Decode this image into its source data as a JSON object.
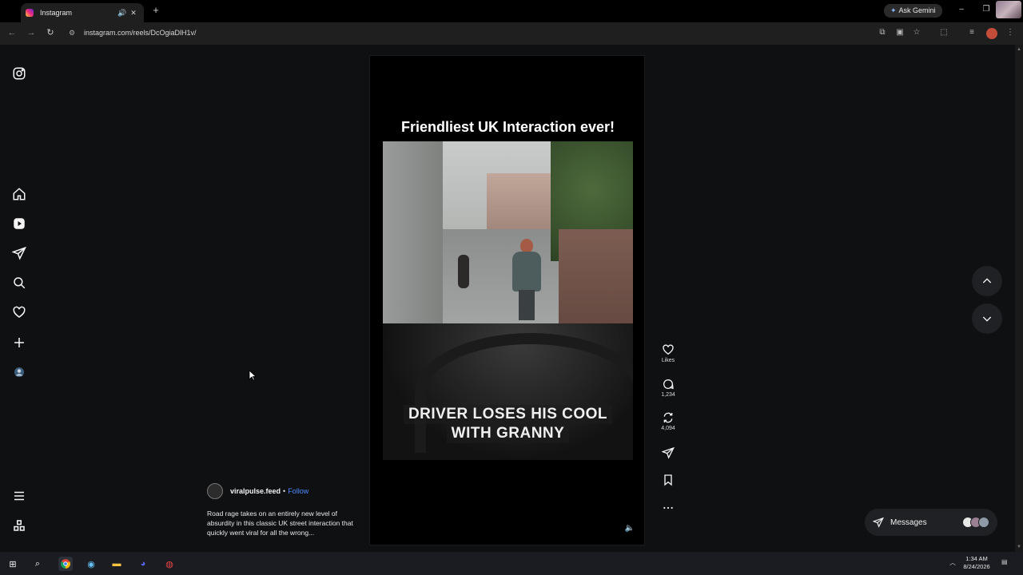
{
  "browser": {
    "tab_title": "Instagram",
    "tab_speaker_icon": "speaker-icon",
    "tab_close": "✕",
    "new_tab": "+",
    "ask_gemini": "Ask Gemini",
    "url": "instagram.com/reels/DcOgiaDlH1v/"
  },
  "reel": {
    "title": "Friendliest UK Interaction ever!",
    "caption_line1": "DRIVER LOSES HIS COOL",
    "caption_line2": "WITH GRANNY",
    "author": "viralpulse.feed",
    "follow": "Follow",
    "description": "Road rage takes on an entirely new level of absurdity in this classic UK street interaction that quickly went viral for all the wrong..."
  },
  "actions": {
    "likes": "Likes",
    "comments": "1,234",
    "reposts": "4,094"
  },
  "messages": {
    "label": "Messages"
  },
  "taskbar": {
    "time": "1:34 AM",
    "date": "8/24/2026"
  },
  "colors": {
    "accent_link": "#4f8cff",
    "background": "#0e1012"
  }
}
